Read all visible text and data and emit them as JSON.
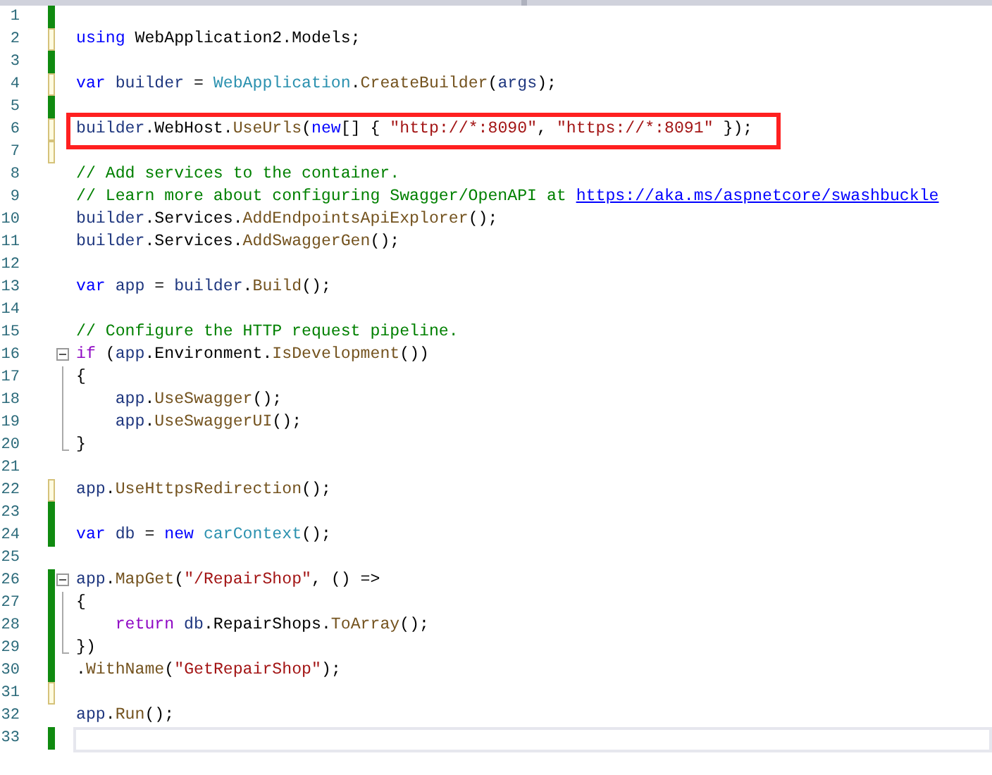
{
  "lines": [
    {
      "number": "1",
      "saved": true
    },
    {
      "number": "2",
      "saved": false,
      "tokens": [
        {
          "kind": "keyword",
          "text": "using"
        },
        {
          "kind": "plain",
          "text": " WebApplication2.Models;"
        }
      ]
    },
    {
      "number": "3",
      "saved": true
    },
    {
      "number": "4",
      "saved": false,
      "tokens": [
        {
          "kind": "keyword",
          "text": "var"
        },
        {
          "kind": "variable",
          "text": " builder"
        },
        {
          "kind": "plain",
          "text": " = "
        },
        {
          "kind": "type",
          "text": "WebApplication"
        },
        {
          "kind": "plain",
          "text": "."
        },
        {
          "kind": "method",
          "text": "CreateBuilder"
        },
        {
          "kind": "plain",
          "text": "("
        },
        {
          "kind": "variable",
          "text": "args"
        },
        {
          "kind": "plain",
          "text": ");"
        }
      ]
    },
    {
      "number": "5",
      "saved": true
    },
    {
      "number": "6",
      "saved": false,
      "boxed": true,
      "tokens": [
        {
          "kind": "variable",
          "text": "builder"
        },
        {
          "kind": "plain",
          "text": ".WebHost."
        },
        {
          "kind": "method",
          "text": "UseUrls"
        },
        {
          "kind": "plain",
          "text": "("
        },
        {
          "kind": "keyword",
          "text": "new"
        },
        {
          "kind": "plain",
          "text": "[] { "
        },
        {
          "kind": "string",
          "text": "\"http://*:8090\""
        },
        {
          "kind": "plain",
          "text": ", "
        },
        {
          "kind": "string",
          "text": "\"https://*:8091\""
        },
        {
          "kind": "plain",
          "text": " });"
        }
      ]
    },
    {
      "number": "7",
      "saved": false
    },
    {
      "number": "8",
      "tokens": [
        {
          "kind": "comment",
          "text": "// Add services to the container."
        }
      ]
    },
    {
      "number": "9",
      "tokens": [
        {
          "kind": "comment",
          "text": "// Learn more about configuring Swagger/OpenAPI at "
        },
        {
          "kind": "link",
          "text": "https://aka.ms/aspnetcore/swashbuckle"
        }
      ]
    },
    {
      "number": "10",
      "tokens": [
        {
          "kind": "variable",
          "text": "builder"
        },
        {
          "kind": "plain",
          "text": ".Services."
        },
        {
          "kind": "method",
          "text": "AddEndpointsApiExplorer"
        },
        {
          "kind": "plain",
          "text": "();"
        }
      ]
    },
    {
      "number": "11",
      "tokens": [
        {
          "kind": "variable",
          "text": "builder"
        },
        {
          "kind": "plain",
          "text": ".Services."
        },
        {
          "kind": "method",
          "text": "AddSwaggerGen"
        },
        {
          "kind": "plain",
          "text": "();"
        }
      ]
    },
    {
      "number": "12"
    },
    {
      "number": "13",
      "tokens": [
        {
          "kind": "keyword",
          "text": "var"
        },
        {
          "kind": "variable",
          "text": " app"
        },
        {
          "kind": "plain",
          "text": " = "
        },
        {
          "kind": "variable",
          "text": "builder"
        },
        {
          "kind": "plain",
          "text": "."
        },
        {
          "kind": "method",
          "text": "Build"
        },
        {
          "kind": "plain",
          "text": "();"
        }
      ]
    },
    {
      "number": "14"
    },
    {
      "number": "15",
      "tokens": [
        {
          "kind": "comment",
          "text": "// Configure the HTTP request pipeline."
        }
      ]
    },
    {
      "number": "16",
      "tokens": [
        {
          "kind": "control",
          "text": "if"
        },
        {
          "kind": "plain",
          "text": " ("
        },
        {
          "kind": "variable",
          "text": "app"
        },
        {
          "kind": "plain",
          "text": ".Environment."
        },
        {
          "kind": "method",
          "text": "IsDevelopment"
        },
        {
          "kind": "plain",
          "text": "())"
        }
      ],
      "children": [
        {
          "number": "17",
          "tokens": [
            {
              "kind": "plain",
              "text": "{"
            }
          ]
        },
        {
          "number": "18",
          "tokens": [
            {
              "kind": "variable",
              "text": "    app"
            },
            {
              "kind": "plain",
              "text": "."
            },
            {
              "kind": "method",
              "text": "UseSwagger"
            },
            {
              "kind": "plain",
              "text": "();"
            }
          ]
        },
        {
          "number": "19",
          "tokens": [
            {
              "kind": "variable",
              "text": "    app"
            },
            {
              "kind": "plain",
              "text": "."
            },
            {
              "kind": "method",
              "text": "UseSwaggerUI"
            },
            {
              "kind": "plain",
              "text": "();"
            }
          ]
        },
        {
          "number": "20",
          "tokens": [
            {
              "kind": "plain",
              "text": "}"
            }
          ]
        }
      ]
    },
    {
      "number": "21"
    },
    {
      "number": "22",
      "saved": false,
      "tokens": [
        {
          "kind": "variable",
          "text": "app"
        },
        {
          "kind": "plain",
          "text": "."
        },
        {
          "kind": "method",
          "text": "UseHttpsRedirection"
        },
        {
          "kind": "plain",
          "text": "();"
        }
      ]
    },
    {
      "number": "23",
      "saved": true
    },
    {
      "number": "24",
      "saved": true,
      "tokens": [
        {
          "kind": "keyword",
          "text": "var"
        },
        {
          "kind": "variable",
          "text": " db"
        },
        {
          "kind": "plain",
          "text": " = "
        },
        {
          "kind": "keyword",
          "text": "new"
        },
        {
          "kind": "type",
          "text": " carContext"
        },
        {
          "kind": "plain",
          "text": "();"
        }
      ]
    },
    {
      "number": "25"
    },
    {
      "number": "26",
      "saved": true,
      "tokens": [
        {
          "kind": "variable",
          "text": "app"
        },
        {
          "kind": "plain",
          "text": "."
        },
        {
          "kind": "method",
          "text": "MapGet"
        },
        {
          "kind": "plain",
          "text": "("
        },
        {
          "kind": "string",
          "text": "\"/RepairShop\""
        },
        {
          "kind": "plain",
          "text": ", () =>"
        }
      ],
      "children": [
        {
          "number": "27",
          "saved": true,
          "tokens": [
            {
              "kind": "plain",
              "text": "{"
            }
          ]
        },
        {
          "number": "28",
          "saved": true,
          "tokens": [
            {
              "kind": "control",
              "text": "    return"
            },
            {
              "kind": "variable",
              "text": " db"
            },
            {
              "kind": "plain",
              "text": ".RepairShops."
            },
            {
              "kind": "method",
              "text": "ToArray"
            },
            {
              "kind": "plain",
              "text": "();"
            }
          ]
        },
        {
          "number": "29",
          "saved": true,
          "tokens": [
            {
              "kind": "plain",
              "text": "})"
            }
          ]
        }
      ]
    },
    {
      "number": "30",
      "saved": true,
      "tokens": [
        {
          "kind": "plain",
          "text": "."
        },
        {
          "kind": "method",
          "text": "WithName"
        },
        {
          "kind": "plain",
          "text": "("
        },
        {
          "kind": "string",
          "text": "\"GetRepairShop\""
        },
        {
          "kind": "plain",
          "text": ");"
        }
      ]
    },
    {
      "number": "31",
      "saved": false
    },
    {
      "number": "32",
      "tokens": [
        {
          "kind": "variable",
          "text": "app"
        },
        {
          "kind": "plain",
          "text": "."
        },
        {
          "kind": "method",
          "text": "Run"
        },
        {
          "kind": "plain",
          "text": "();"
        }
      ]
    },
    {
      "number": "33",
      "saved": true,
      "current": true
    }
  ]
}
